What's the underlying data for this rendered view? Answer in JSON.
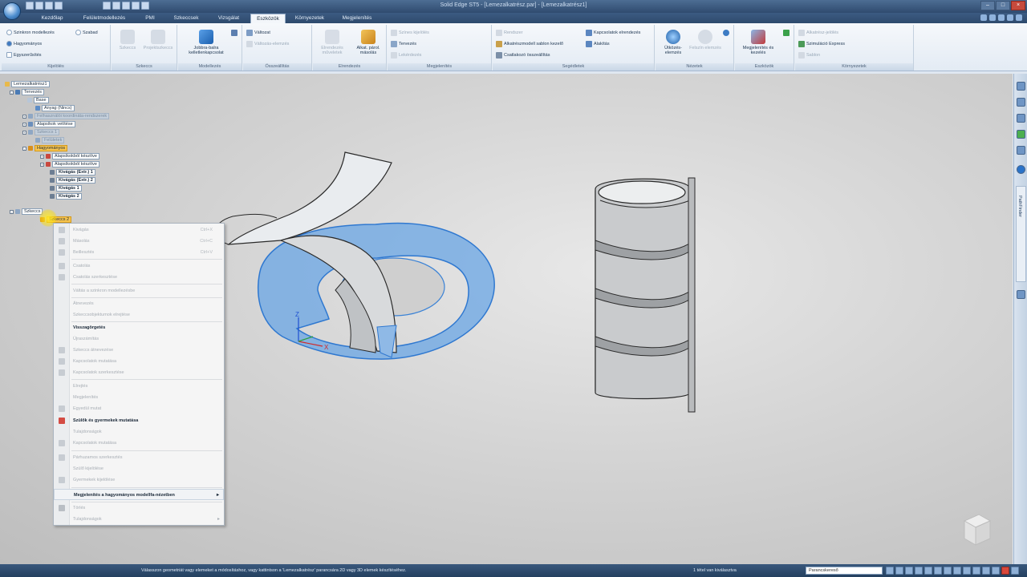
{
  "app": {
    "title": "Solid Edge ST5 - [Lemezalkatrész.par] - [Lemezalkatrész1]"
  },
  "tabs": [
    {
      "label": "Kezdőlap"
    },
    {
      "label": "Felületmodellezés"
    },
    {
      "label": "PMI"
    },
    {
      "label": "Szkeccsek"
    },
    {
      "label": "Vizsgálat"
    },
    {
      "label": "Eszközök"
    },
    {
      "label": "Környezetek"
    },
    {
      "label": "Megjelenítés"
    }
  ],
  "ribbon": {
    "groups": [
      {
        "label": "Kijelölés"
      },
      {
        "label": "Szkeccs"
      },
      {
        "label": "Modellezés"
      },
      {
        "label": "Összeállítás"
      },
      {
        "label": "Elrendezés"
      },
      {
        "label": "Megjelenítés"
      },
      {
        "label": "Segédletek"
      },
      {
        "label": "Nézetek"
      },
      {
        "label": "Eszközök"
      },
      {
        "label": "Környezetek"
      }
    ],
    "selection": {
      "option1": "Szinkron modellezés",
      "option2": "Szabad",
      "option3": "Hagyományos",
      "option4": "Egyszerűsítés"
    },
    "sketch": {
      "btn1": "Szkeccs",
      "btn2": "Projektszkeccs"
    },
    "model": {
      "btn1": "Jobbra-balra",
      "btn2": "kelletlenkapcsolat"
    },
    "assembly": {
      "item1": "Változat",
      "item2": "Változás-elemzés"
    },
    "layout": {
      "btn1": "Elrendezés műveletek",
      "btn2": "Alkat. párol. másolás"
    },
    "display": {
      "item1": "Színes kijelölés",
      "item2": "Tervezés",
      "item3": "Lekérdezés"
    },
    "helpers": {
      "item1": "Rendszer",
      "item2": "Alkatrészmodell sablon kezelő",
      "item3": "Csatlakozó összeállítás",
      "item4": "Kapcsolatok elrendezés",
      "item5": "Alakítás"
    },
    "views": {
      "btn1": "Ütközés-elemzés",
      "btn2": "Felszín elemzés"
    },
    "tools": {
      "btn1": "Megjelenítés és kezelés"
    },
    "envs": {
      "item1": "Alkatrész-jelölés",
      "item2": "Szimuláció Express",
      "item3": "Sablon"
    }
  },
  "tree": {
    "items": [
      {
        "label": "Lemezalkatrész1"
      },
      {
        "label": "Tervezés"
      },
      {
        "label": "Base"
      },
      {
        "label": "Anyag (Nincs)"
      },
      {
        "label": "Felhasználói koordináta-rendszerek"
      },
      {
        "label": "Alapsíkok vetítése"
      },
      {
        "label": "Szkeccs 1"
      },
      {
        "label": "Felületek"
      },
      {
        "label": "Hagyományos"
      },
      {
        "label": "Alapsíkokból készítve"
      },
      {
        "label": "Alapsíkokból készítve"
      },
      {
        "label": "Kivágás (Extr.) 1"
      },
      {
        "label": "Kivágás (Extr.) 2"
      },
      {
        "label": "Kivágás 1"
      },
      {
        "label": "Kivágás 2"
      },
      {
        "label": "Szkeccs"
      },
      {
        "label": "Szkeccs 2"
      }
    ]
  },
  "context_menu": {
    "items": [
      {
        "label": "Kivágás",
        "shortcut": "Ctrl+X"
      },
      {
        "label": "Másolás",
        "shortcut": "Ctrl+C"
      },
      {
        "label": "Beillesztés",
        "shortcut": "Ctrl+V"
      },
      {
        "label": "Csatolás",
        "shortcut": ""
      },
      {
        "label": "Csatolás szerkesztése",
        "shortcut": ""
      },
      {
        "label": "Váltás a szinkron modellezésbe",
        "shortcut": ""
      },
      {
        "label": "Átnevezés",
        "shortcut": ""
      },
      {
        "label": "Szkeccsobjektumok elrejtése",
        "shortcut": ""
      },
      {
        "label": "Visszagörgetés",
        "shortcut": ""
      },
      {
        "label": "Újraszámítás",
        "shortcut": ""
      },
      {
        "label": "Szkeccs átnevezése",
        "shortcut": ""
      },
      {
        "label": "Kapcsolatok mutatása",
        "shortcut": ""
      },
      {
        "label": "Kapcsolatok szerkesztése",
        "shortcut": ""
      },
      {
        "label": "Elrejtés",
        "shortcut": ""
      },
      {
        "label": "Megjelenítés",
        "shortcut": ""
      },
      {
        "label": "Egyedül mutat",
        "shortcut": ""
      },
      {
        "label": "Szülők és gyermekek mutatása",
        "shortcut": ""
      },
      {
        "label": "Tulajdonságok",
        "shortcut": ""
      },
      {
        "label": "Kapcsolatok mutatása",
        "shortcut": ""
      },
      {
        "label": "Párhuzamos szerkesztés",
        "shortcut": ""
      },
      {
        "label": "Szülő kijelölése",
        "shortcut": ""
      },
      {
        "label": "Gyermekek kijelölése",
        "shortcut": ""
      },
      {
        "label": "Megjelenítés a hagyományos modellfa-nézetben",
        "shortcut": "▸"
      },
      {
        "label": "Törlés",
        "shortcut": ""
      },
      {
        "label": "Tulajdonságok",
        "shortcut": "▸"
      }
    ]
  },
  "scene": {
    "axis_x": "X",
    "axis_z": "Z"
  },
  "rightbar": {
    "label": "PathFinder"
  },
  "status": {
    "message": "Válasszon geometriát vagy elemeket a módosításhoz, vagy kattintson a 'Lemezalkatrész' parancsára 2D vagy 3D elemek készítéséhez.",
    "count": "1 tétel van kiválasztva",
    "command_finder": "Parancskereső"
  },
  "colors": {
    "accent": "#5b9be0",
    "titlebar": "#2f4b6f",
    "highlight": "#f7c44f"
  }
}
